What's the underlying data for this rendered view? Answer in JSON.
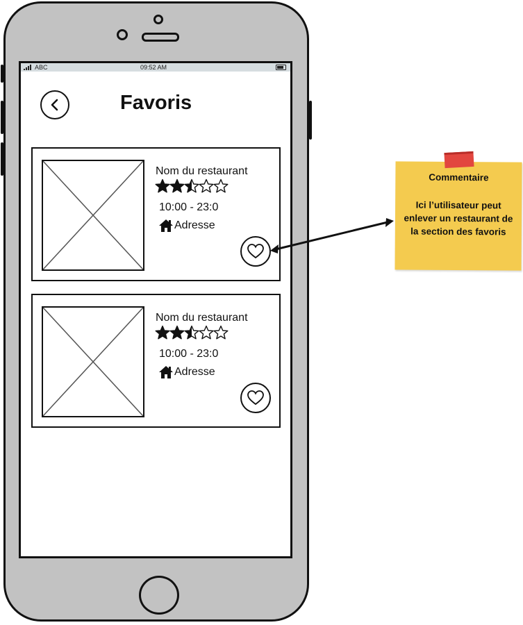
{
  "status_bar": {
    "carrier": "ABC",
    "time": "09:52 AM"
  },
  "header": {
    "title": "Favoris"
  },
  "restaurants": [
    {
      "name": "Nom du restaurant",
      "rating": 2.5,
      "max_rating": 5,
      "hours": "10:00 - 23:0",
      "address": "Adresse"
    },
    {
      "name": "Nom du restaurant",
      "rating": 2.5,
      "max_rating": 5,
      "hours": "10:00 - 23:0",
      "address": "Adresse"
    }
  ],
  "annotation": {
    "title": "Commentaire",
    "text": "Ici l’utilisateur peut enlever un restaurant de la section des favoris"
  },
  "colors": {
    "sticky": "#f4cb4f",
    "tape": "#e2463f",
    "phone_body": "#c2c2c2"
  },
  "icons": [
    "back-chevron-icon",
    "star-icon",
    "house-icon",
    "heart-icon",
    "image-placeholder-icon"
  ]
}
